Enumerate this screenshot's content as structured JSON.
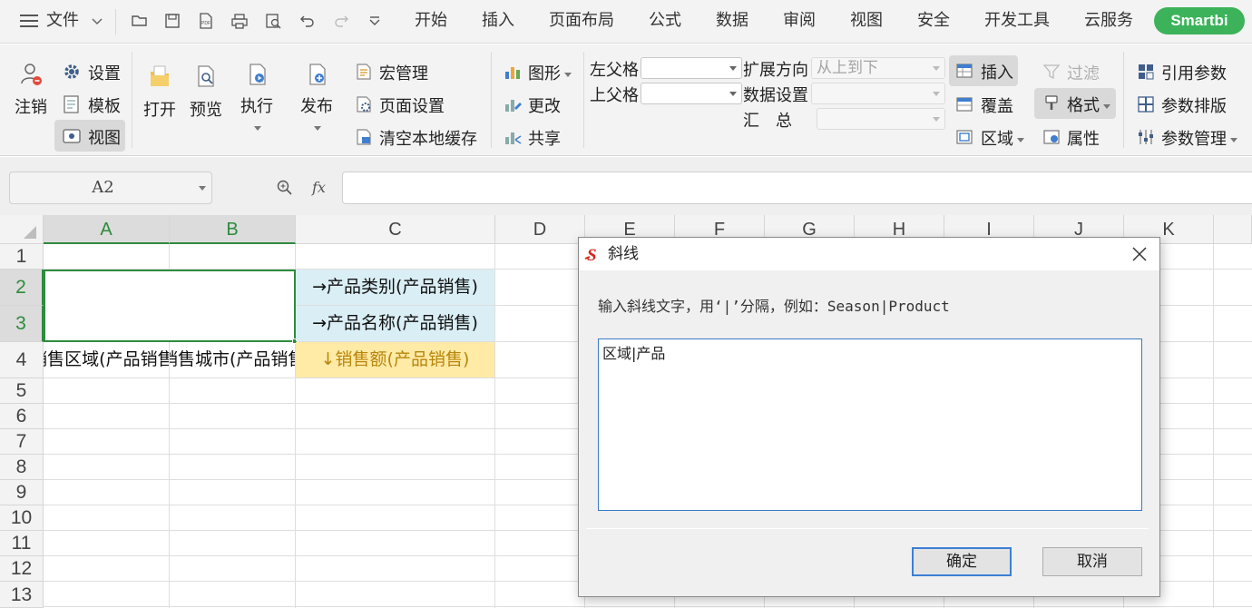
{
  "menubar": {
    "file_label": "文件",
    "tabs": [
      "开始",
      "插入",
      "页面布局",
      "公式",
      "数据",
      "审阅",
      "视图",
      "安全",
      "开发工具",
      "云服务"
    ],
    "smartbi_label": "Smartbi"
  },
  "ribbon": {
    "logout": "注销",
    "settings": "设置",
    "template": "模板",
    "view": "视图",
    "open": "打开",
    "preview": "预览",
    "execute": "执行",
    "publish": "发布",
    "macro": "宏管理",
    "page_setup": "页面设置",
    "clear_cache": "清空本地缓存",
    "chart": "图形",
    "change": "更改",
    "share": "共享",
    "left_parent": "左父格",
    "top_parent": "上父格",
    "expand_dir": "扩展方向",
    "expand_dir_value": "从上到下",
    "data_settings": "数据设置",
    "summary": "汇　总",
    "insert": "插入",
    "cover": "覆盖",
    "region": "区域",
    "filter": "过滤",
    "format": "格式",
    "properties": "属性",
    "ref_params": "引用参数",
    "param_layout": "参数排版",
    "param_manage": "参数管理"
  },
  "formula_bar": {
    "cell_ref": "A2",
    "fx_label": "fx"
  },
  "sheet": {
    "columns": [
      "A",
      "B",
      "C",
      "D",
      "E",
      "F",
      "G",
      "H",
      "I",
      "J",
      "K"
    ],
    "rows": [
      "1",
      "2",
      "3",
      "4",
      "5",
      "6",
      "7",
      "8",
      "9",
      "10",
      "11",
      "12",
      "13"
    ],
    "c2": "→产品类别(产品销售)",
    "c3": "→产品名称(产品销售)",
    "a4": "销售区域(产品销售)",
    "b4": "销售城市(产品销售)",
    "c4": "↓销售额(产品销售)"
  },
  "dialog": {
    "title": "斜线",
    "hint": "输入斜线文字，用‘|’分隔，例如：Season|Product",
    "text_value": "区域|产品",
    "ok_label": "确定",
    "cancel_label": "取消"
  },
  "colors": {
    "accent_green": "#2e8b3e",
    "smartbi_green": "#3cb35a",
    "cell_blue": "#daeef5",
    "cell_yellow": "#ffeaa6",
    "measure_text": "#b8860b"
  }
}
